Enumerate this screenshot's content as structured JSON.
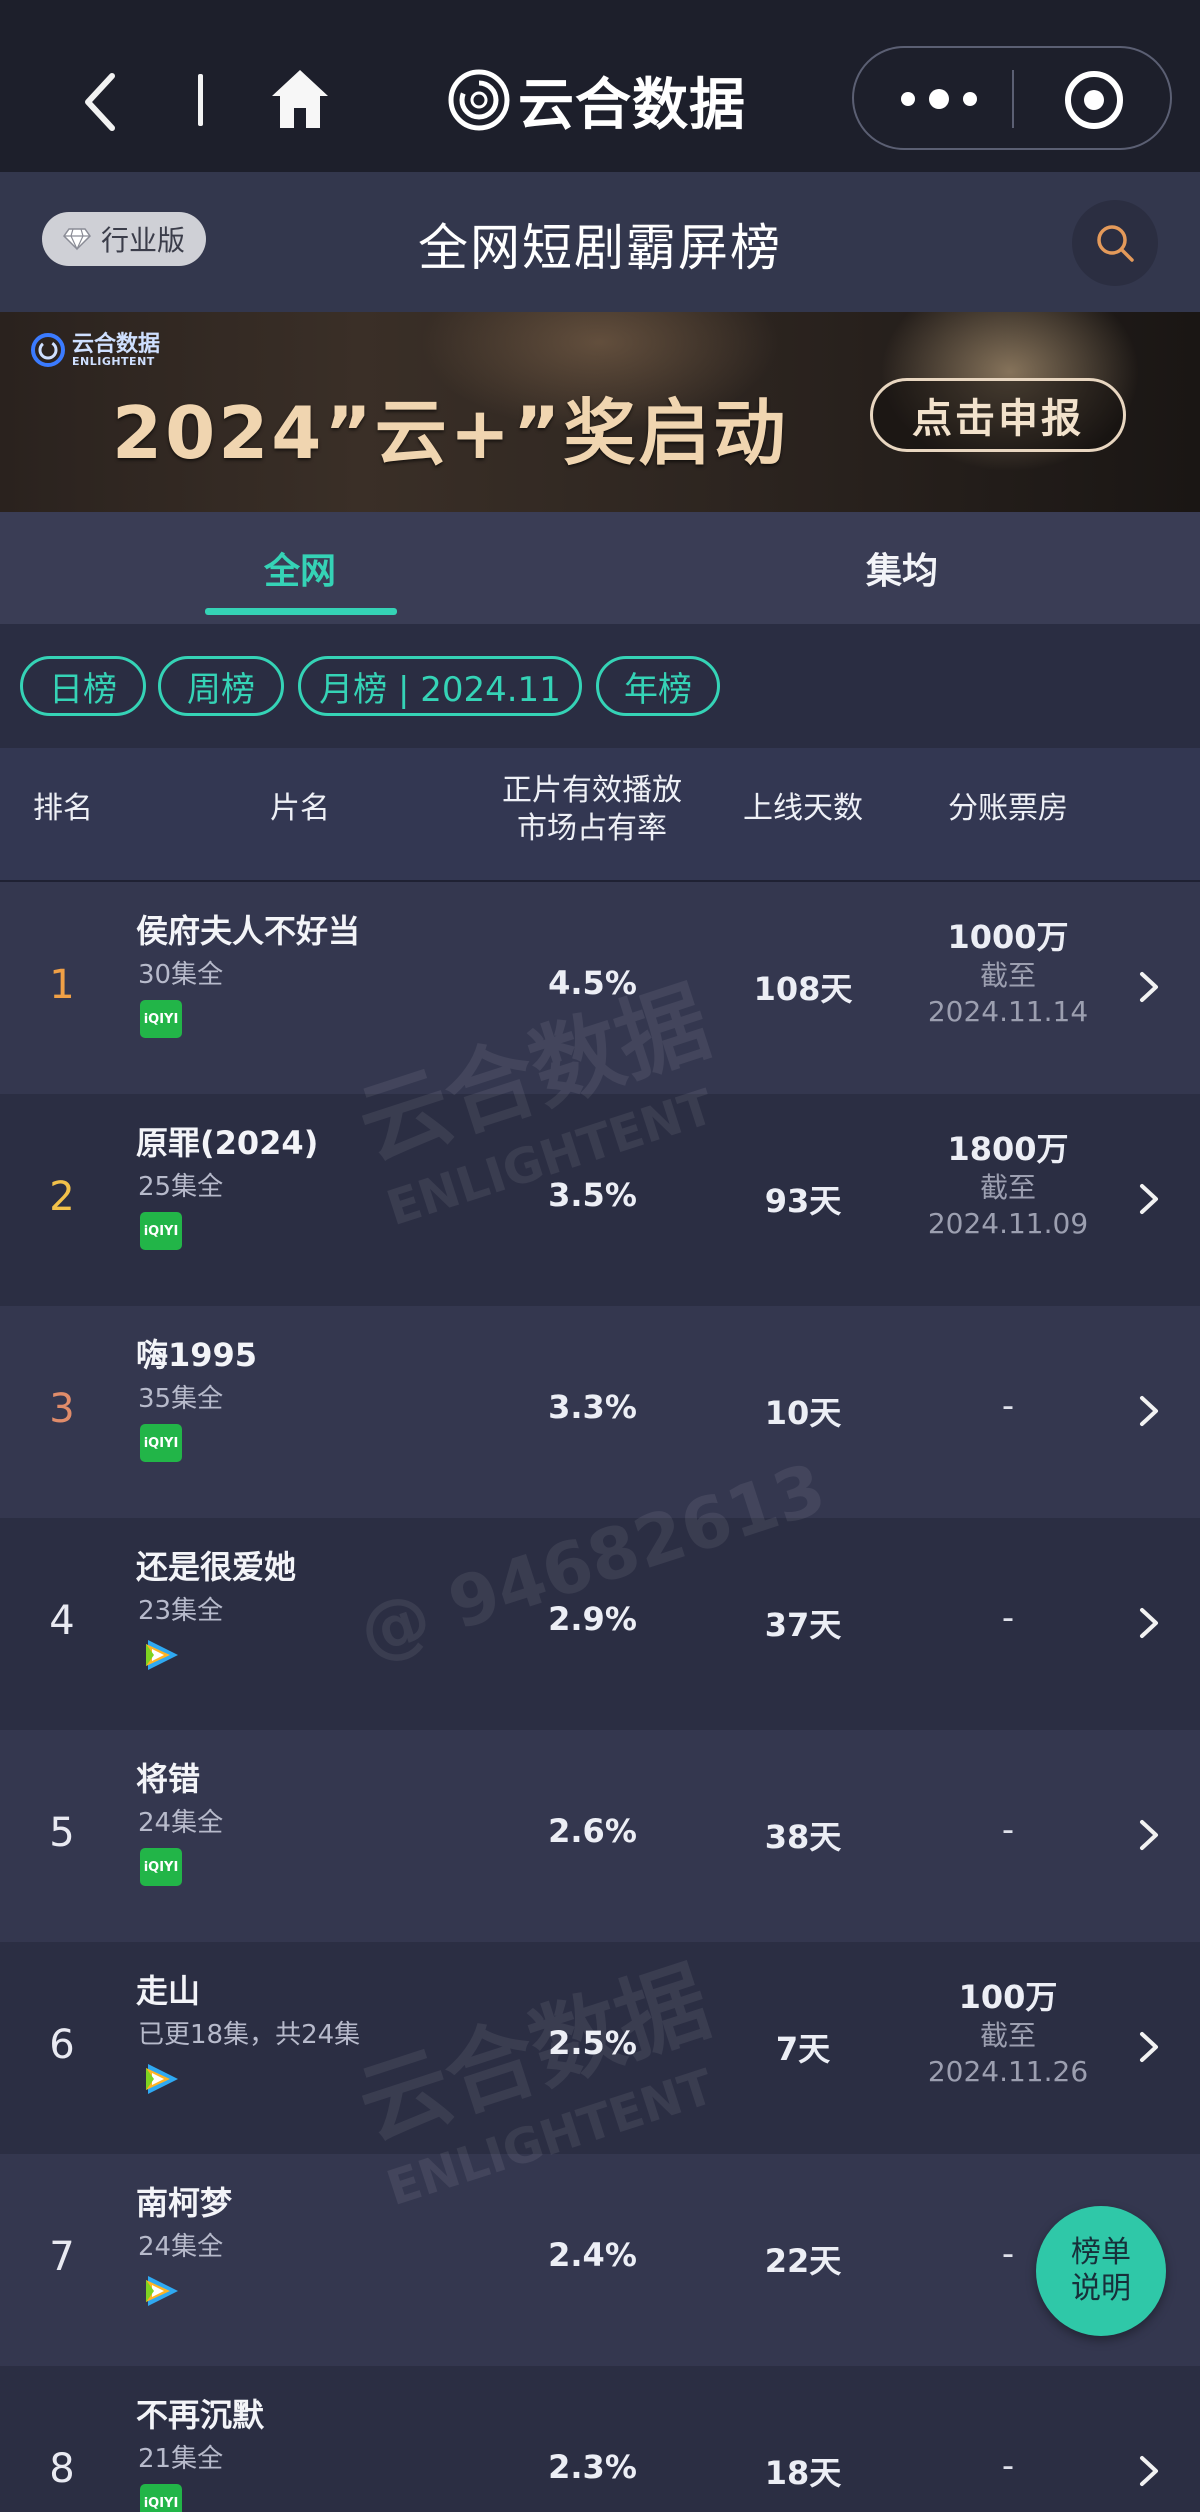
{
  "nav": {
    "brand_name": "云合数据"
  },
  "header": {
    "edition_label": "行业版",
    "page_title": "全网短剧霸屏榜"
  },
  "banner": {
    "logo_cn": "云合数据",
    "logo_en": "ENLIGHTENT",
    "headline": "2024”云+”奖启动",
    "cta_label": "点击申报"
  },
  "tabs": [
    {
      "label": "全网",
      "active": true
    },
    {
      "label": "集均",
      "active": false
    }
  ],
  "filters": [
    {
      "label": "日榜"
    },
    {
      "label": "周榜"
    },
    {
      "label": "月榜 | 2024.11",
      "active": true
    },
    {
      "label": "年榜"
    }
  ],
  "table": {
    "headers": {
      "rank": "排名",
      "title": "片名",
      "share_line1": "正片有效播放",
      "share_line2": "市场占有率",
      "days": "上线天数",
      "box_office": "分账票房"
    },
    "rows": [
      {
        "rank": "1",
        "title": "侯府夫人不好当",
        "episodes": "30集全",
        "platform": "iqiyi-icon",
        "share": "4.5%",
        "days": "108天",
        "box": "1000万",
        "asof": "截至",
        "date": "2024.11.14"
      },
      {
        "rank": "2",
        "title": "原罪(2024)",
        "episodes": "25集全",
        "platform": "iqiyi-icon",
        "share": "3.5%",
        "days": "93天",
        "box": "1800万",
        "asof": "截至",
        "date": "2024.11.09"
      },
      {
        "rank": "3",
        "title": "嗨1995",
        "episodes": "35集全",
        "platform": "iqiyi-icon",
        "share": "3.3%",
        "days": "10天",
        "box": "-"
      },
      {
        "rank": "4",
        "title": "还是很爱她",
        "episodes": "23集全",
        "platform": "tencent-video-icon",
        "share": "2.9%",
        "days": "37天",
        "box": "-"
      },
      {
        "rank": "5",
        "title": "将错",
        "episodes": "24集全",
        "platform": "iqiyi-icon",
        "share": "2.6%",
        "days": "38天",
        "box": "-"
      },
      {
        "rank": "6",
        "title": "走山",
        "episodes": "已更18集，共24集",
        "platform": "tencent-video-icon",
        "share": "2.5%",
        "days": "7天",
        "box": "100万",
        "asof": "截至",
        "date": "2024.11.26"
      },
      {
        "rank": "7",
        "title": "南柯梦",
        "episodes": "24集全",
        "platform": "tencent-video-icon",
        "share": "2.4%",
        "days": "22天",
        "box": "-"
      },
      {
        "rank": "8",
        "title": "不再沉默",
        "episodes": "21集全",
        "platform": "iqiyi-icon",
        "share": "2.3%",
        "days": "18天",
        "box": "-"
      }
    ]
  },
  "fab": {
    "line1": "榜单",
    "line2": "说明"
  },
  "watermark": {
    "brand_cn": "云合数据",
    "brand_en": "ENLIGHTENT",
    "user_id": "@ 94682613"
  },
  "colors": {
    "accent": "#35d3b6",
    "background": "#2a2d42",
    "rank_1": "#f0a046",
    "rank_2": "#f2c14a",
    "rank_3": "#e08c6a",
    "iqiyi_green": "#22b548"
  }
}
